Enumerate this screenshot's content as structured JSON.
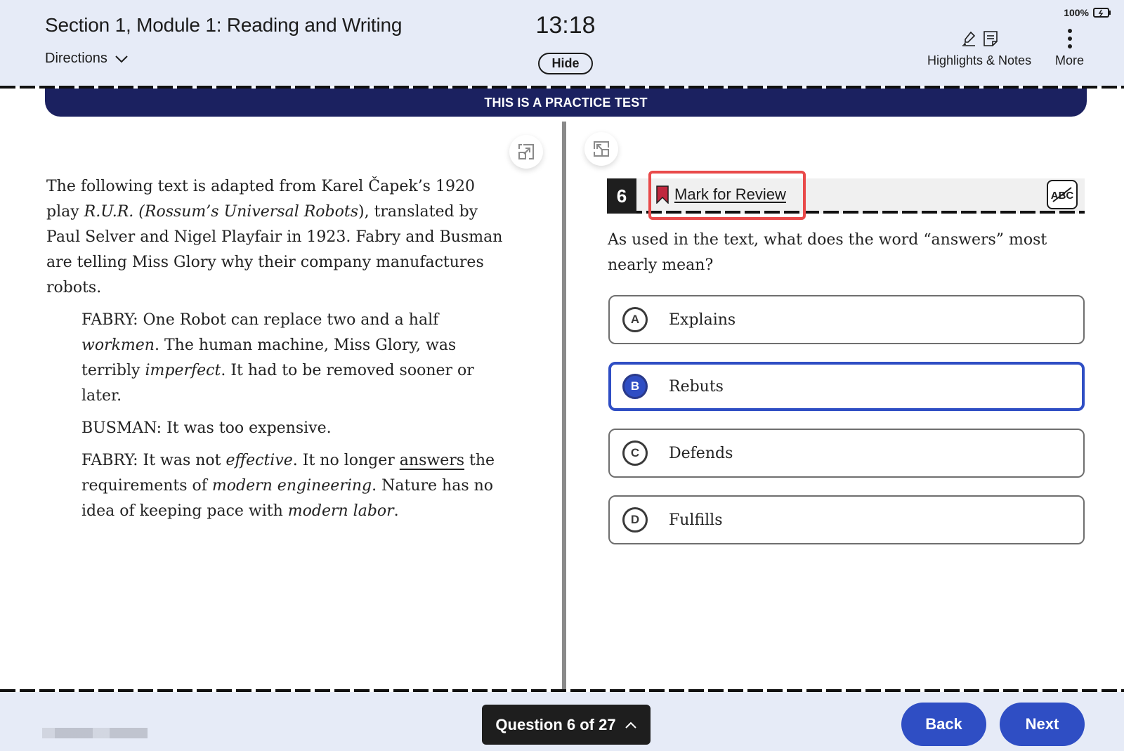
{
  "header": {
    "title": "Section 1, Module 1: Reading and Writing",
    "directions_label": "Directions",
    "timer": "13:18",
    "hide_label": "Hide",
    "battery": "100%",
    "highlights_notes_label": "Highlights & Notes",
    "more_label": "More"
  },
  "banner": {
    "text": "THIS IS A PRACTICE TEST",
    "color": "#1b2160"
  },
  "passage": {
    "intro_1": "The following text is adapted from Karel Čapek’s 1920 play ",
    "intro_title": "R.U.R. (Rossum’s Universal Robots",
    "intro_2": "), translated by Paul Selver and Nigel Playfair in 1923. Fabry and Busman are telling Miss Glory why their company manufactures robots.",
    "p1_a": "FABRY: One Robot can replace two and a half ",
    "p1_em1": "workmen",
    "p1_b": ". The human machine, Miss Glory, was terribly ",
    "p1_em2": "imperfect",
    "p1_c": ". It had to be removed sooner or later.",
    "p2": "BUSMAN: It was too expensive.",
    "p3_a": "FABRY: It was not ",
    "p3_em1": "effective",
    "p3_b": ". It no longer ",
    "p3_ul": "answers",
    "p3_c": " the requirements of ",
    "p3_em2": "modern engineering",
    "p3_d": ". Nature has no idea of keeping pace with ",
    "p3_em3": "modern labor",
    "p3_e": "."
  },
  "question": {
    "number": "6",
    "mark_for_review_label": "Mark for Review",
    "text": "As used in the text, what does the word “answers” most nearly mean?",
    "options": [
      {
        "letter": "A",
        "text": "Explains",
        "selected": false
      },
      {
        "letter": "B",
        "text": "Rebuts",
        "selected": true
      },
      {
        "letter": "C",
        "text": "Defends",
        "selected": false
      },
      {
        "letter": "D",
        "text": "Fulfills",
        "selected": false
      }
    ],
    "selected_color": "#2f4ec4",
    "review_highlight_color": "#e94a4a",
    "bookmark_color": "#c0283e"
  },
  "footer": {
    "question_nav_label": "Question 6 of 27",
    "back_label": "Back",
    "next_label": "Next",
    "button_color": "#2f4ec4"
  }
}
